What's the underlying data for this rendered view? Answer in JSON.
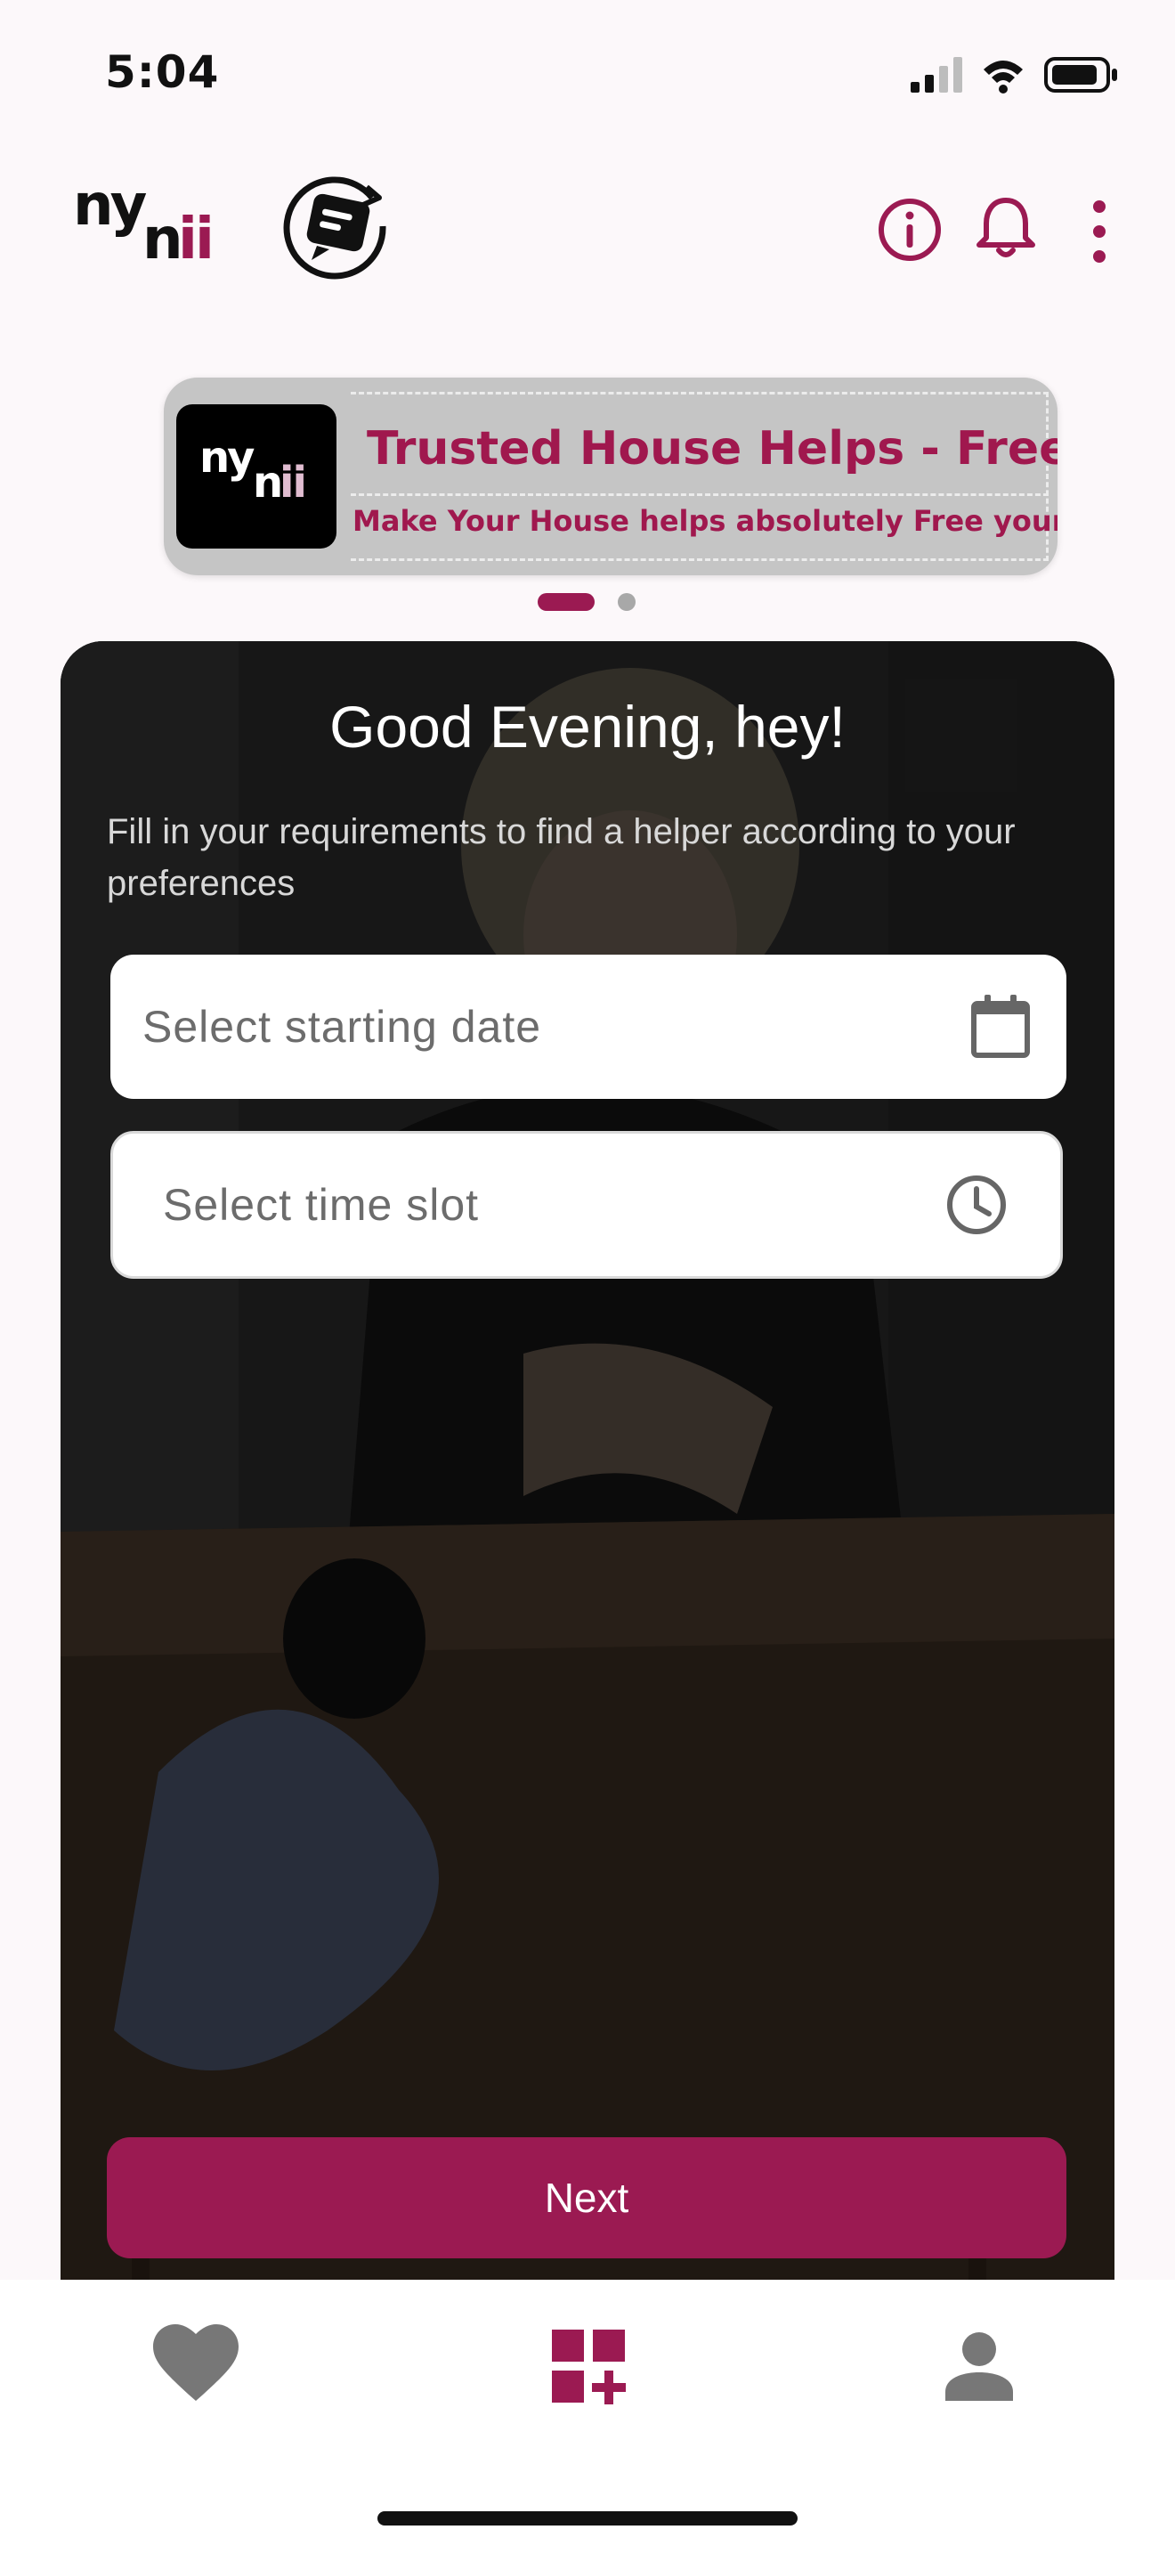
{
  "status_bar": {
    "time": "5:04"
  },
  "header": {
    "logo_text": "nynii",
    "icons": [
      "chat-refresh-icon",
      "info-icon",
      "bell-icon",
      "more-vertical-icon"
    ]
  },
  "banner": {
    "logo_text": "nynii",
    "title": "Trusted House Helps - Free",
    "subtitle": "Make Your House helps absolutely Free yourself"
  },
  "carousel": {
    "active_index": 0
  },
  "main": {
    "greeting": "Good Evening, hey!",
    "intro": "Fill in your requirements to find a helper according to your preferences",
    "date_field": {
      "placeholder": "Select starting date",
      "icon": "calendar-icon"
    },
    "time_field": {
      "placeholder": "Select time slot",
      "icon": "clock-icon"
    },
    "next_label": "Next"
  },
  "bottom_nav": {
    "items": [
      {
        "icon": "heart-icon",
        "active": false
      },
      {
        "icon": "dashboard-add-icon",
        "active": true
      },
      {
        "icon": "person-icon",
        "active": false
      }
    ]
  },
  "colors": {
    "brand": "#9b1a52",
    "background": "#fcf8fa"
  }
}
